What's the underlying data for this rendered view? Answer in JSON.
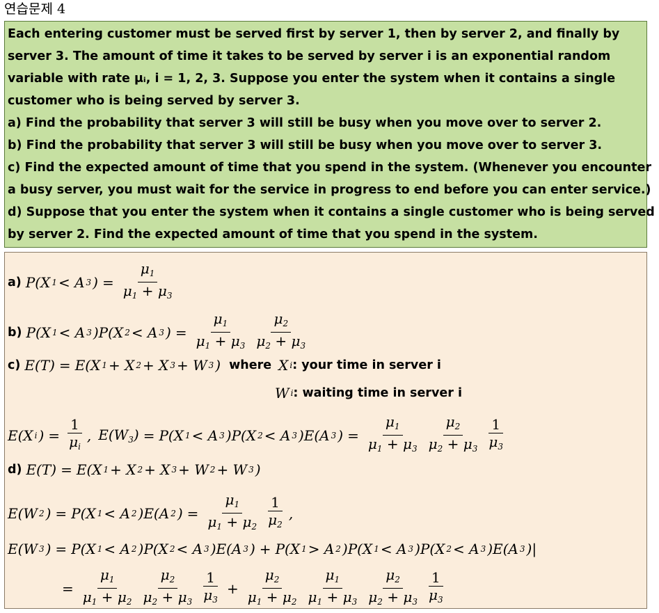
{
  "title": "연습문제 4",
  "problem": {
    "lines": [
      "Each entering customer must be served first by server 1, then by server 2, and finally by",
      "server 3. The amount of time it takes to be served by server i is an exponential random",
      "variable with rate μᵢ, i = 1, 2, 3. Suppose you enter the system when it contains a single",
      "customer who is being served by server 3.",
      "a) Find the probability that server 3 will still be busy when you move over to server 2.",
      "b) Find the probability that server 3 will still be busy when you move over to server 3.",
      "c) Find the expected amount of time that you spend in the system. (Whenever you encounter",
      "a busy server, you must wait for the service in progress to end before you can enter service.)",
      "d) Suppose that you enter the system when it contains a single customer who is being served",
      "by server 2. Find the expected amount of time that you spend in the system."
    ]
  },
  "solution": {
    "a_label": "a)",
    "b_label": "b)",
    "c_label": "c)",
    "c_where": "where",
    "c_xi_desc": ": your time in server i",
    "c_wi_desc": ": waiting time in server i",
    "d_label": "d)"
  }
}
